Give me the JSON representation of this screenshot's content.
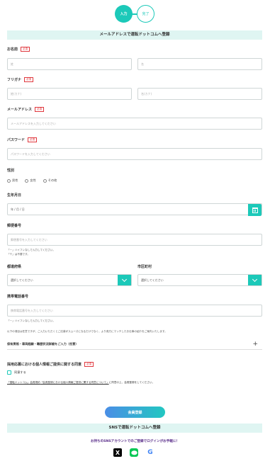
{
  "steps": {
    "current": "入力",
    "next": "完了"
  },
  "section_email": "メールアドレスで運転ドットコムへ登録",
  "required_badge": "必須",
  "name": {
    "label": "お名前",
    "last_placeholder": "姓",
    "first_placeholder": "名"
  },
  "furigana": {
    "label": "フリガナ",
    "last_placeholder": "姓(カナ)",
    "first_placeholder": "名(カナ)"
  },
  "email": {
    "label": "メールアドレス",
    "placeholder": "メールアドレスを入力してください"
  },
  "password": {
    "label": "パスワード",
    "placeholder": "パスワードを入力してください"
  },
  "gender": {
    "label": "性別",
    "options": [
      "男性",
      "女性",
      "その他"
    ]
  },
  "birthdate": {
    "label": "生年月日",
    "placeholder": "年 / 月 / 日"
  },
  "zipcode": {
    "label": "郵便番号",
    "placeholder": "郵便番号を入力してください",
    "note1": "「－」ハイフンなしで入力してください。",
    "note2": "「〒」は不要です。"
  },
  "prefecture": {
    "label": "都道府県",
    "selected": "選択してください"
  },
  "city": {
    "label": "市区町村",
    "selected": "選択してください"
  },
  "phone": {
    "label": "携帯電話番号",
    "placeholder": "携帯電話番号を入力してください",
    "note": "「－」ハイフンなしで入力してください。"
  },
  "optional_note": "以下の項目は任意ですが、ご入力いただくとご応募がスムーズになるだけでなく、より貴方にマッチしたお仕事の紹介をご案内いたします。",
  "expander_label": "保有資格・車両経験・職歴状況詳細をご入力（任意）",
  "consent": {
    "label": "採用応募における個人情報ご提供に関する同意",
    "checkbox_label": "同意する",
    "link1": "「運転ドットコム」会員規約",
    "link2": "「会員登録における個人情報ご提供に関する同意について」",
    "suffix": "に同意の上、会員登録をしてください。"
  },
  "submit_label": "会員登録",
  "section_sns": "SNSで運転ドットコムへ登録",
  "sns_note": "お持ちのSNSアカウントでのご登録でログインがお手軽に！",
  "sns_icons": [
    "x-icon",
    "line-icon",
    "google-icon"
  ],
  "colors": {
    "accent": "#1cc9b9",
    "required": "#e0383e",
    "header_bg": "#dff5f2"
  }
}
